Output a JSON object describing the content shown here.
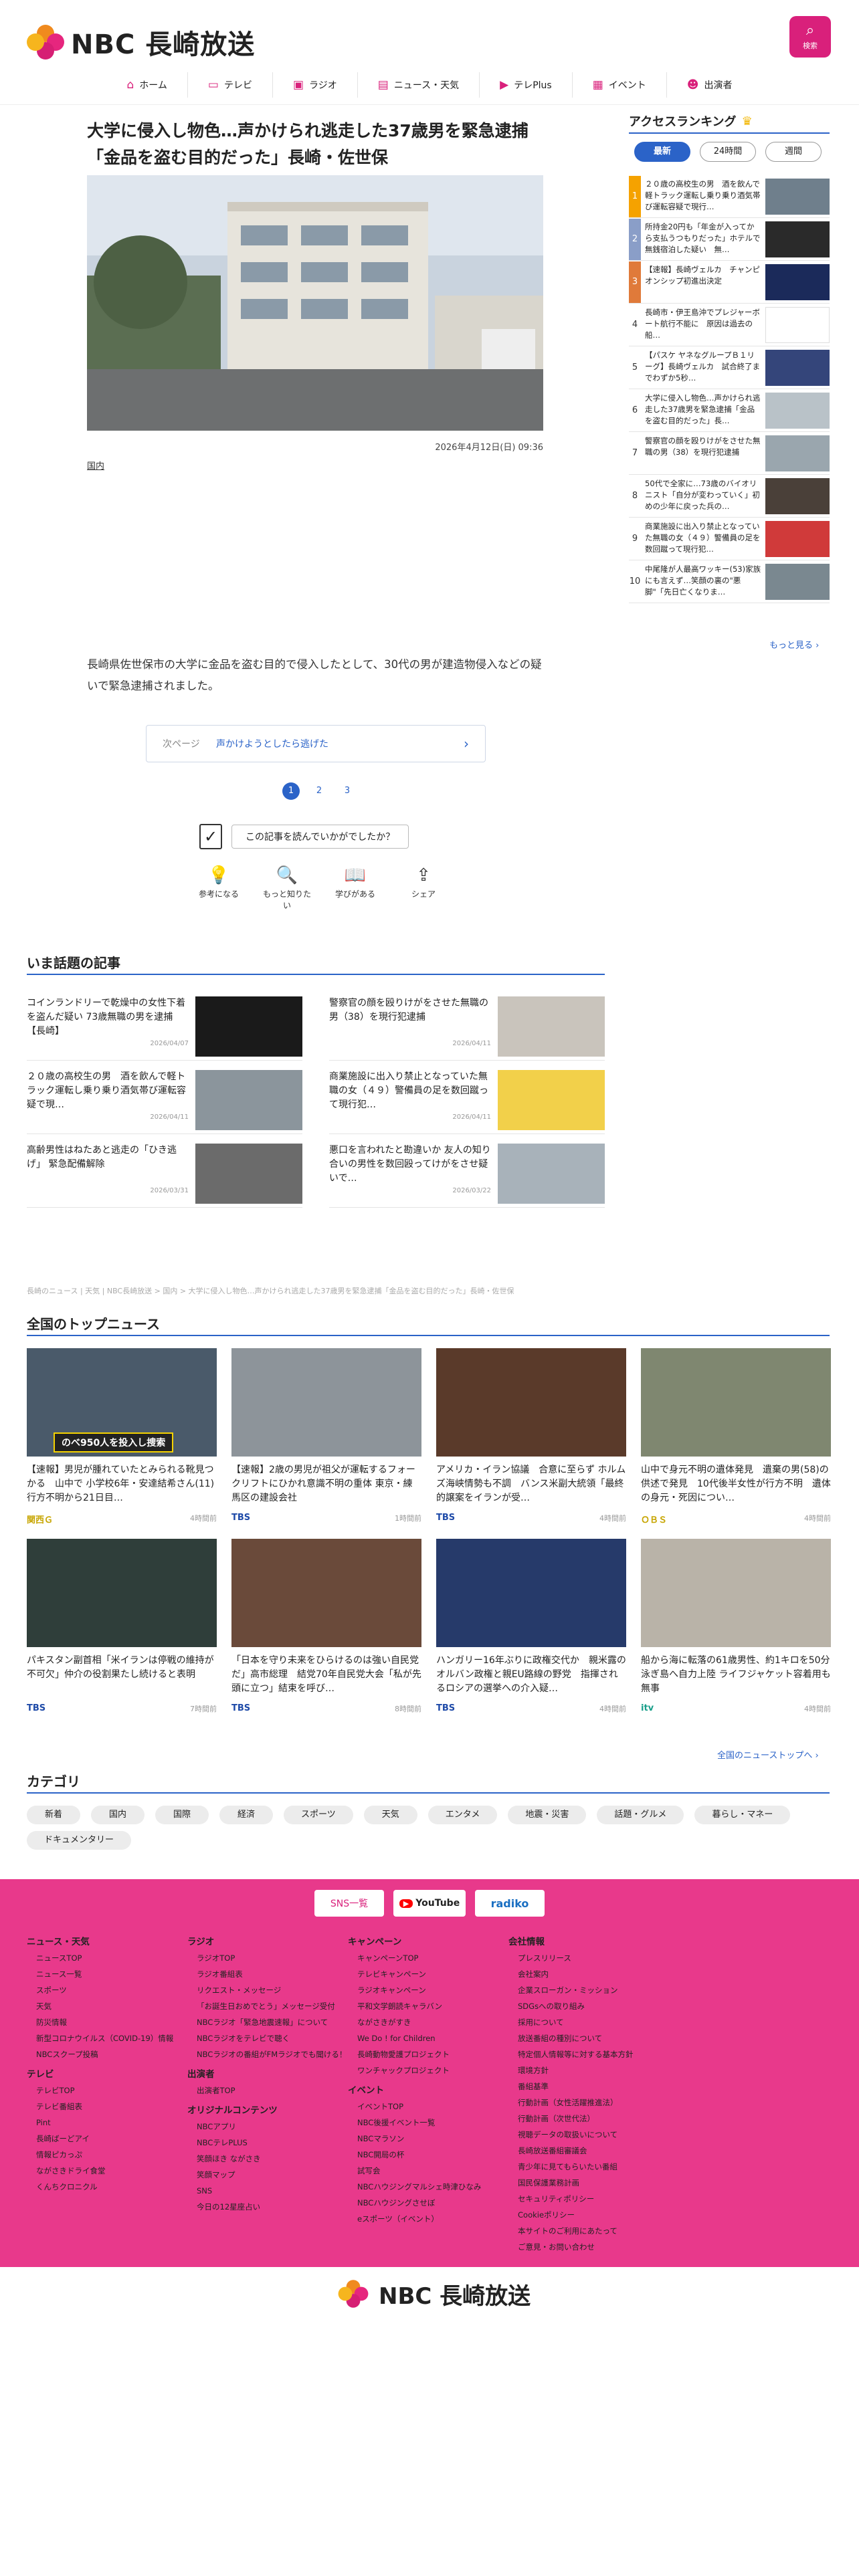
{
  "site": {
    "logo_text": "NBC 長崎放送",
    "search_label": "検索"
  },
  "gnav": [
    {
      "icon": "home-icon",
      "glyph": "⌂",
      "label": "ホーム"
    },
    {
      "icon": "tv-icon",
      "glyph": "▭",
      "label": "テレビ"
    },
    {
      "icon": "radio-icon",
      "glyph": "▣",
      "label": "ラジオ"
    },
    {
      "icon": "news-icon",
      "glyph": "▤",
      "label": "ニュース・天気"
    },
    {
      "icon": "play-icon",
      "glyph": "▶",
      "label": "テレPlus"
    },
    {
      "icon": "calendar-icon",
      "glyph": "▦",
      "label": "イベント"
    },
    {
      "icon": "people-icon",
      "glyph": "☻",
      "label": "出演者"
    }
  ],
  "article": {
    "headline": "大学に侵入し物色…声かけられ逃走した37歳男を緊急逮捕「金品を盗む目的だった」長崎・佐世保",
    "date": "2026年4月12日(日) 09:36",
    "category": "国内",
    "lead": "長崎県佐世保市の大学に金品を盗む目的で侵入したとして、30代の男が建造物侵入などの疑いで緊急逮捕されました。",
    "next_label": "次ページ",
    "next_title": "声かけようとしたら逃げた",
    "pages": [
      "1",
      "2",
      "3"
    ],
    "feedback_q": "この記事を読んでいかがでしたか？",
    "reactions": [
      {
        "icon": "lightbulb-icon",
        "glyph": "💡",
        "label": "参考になる"
      },
      {
        "icon": "search-icon",
        "glyph": "🔍",
        "label": "もっと知りたい"
      },
      {
        "icon": "book-icon",
        "glyph": "📖",
        "label": "学びがある"
      },
      {
        "icon": "share-icon",
        "glyph": "⇪",
        "label": "シェア"
      }
    ]
  },
  "ranking": {
    "title": "アクセスランキング",
    "tabs": [
      "最新",
      "24時間",
      "週間"
    ],
    "more": "もっと見る ›",
    "items": [
      {
        "n": "1",
        "t": "２０歳の高校生の男　酒を飲んで軽トラック運転し乗り乗り酒気帯び運転容疑で現行…"
      },
      {
        "n": "2",
        "t": "所持金20円も「年金が入ってから支払うつもりだった」ホテルで無銭宿泊した疑い　無…"
      },
      {
        "n": "3",
        "t": "【速報】長崎ヴェルカ　チャンピオンシップ初進出決定"
      },
      {
        "n": "4",
        "t": "長崎市・伊王島沖でプレジャーボート航行不能に　原因は過去の船…"
      },
      {
        "n": "5",
        "t": "【パスケ ヤネなグループＢ１リーグ】長崎ヴェルカ　試合終了までわずか5秒…"
      },
      {
        "n": "6",
        "t": "大学に侵入し物色…声かけられ逃走した37歳男を緊急逮捕「金品を盗む目的だった」長…"
      },
      {
        "n": "7",
        "t": "警察官の顔を殴りけがをさせた無職の男（38）を現行犯逮捕"
      },
      {
        "n": "8",
        "t": "50代で全家に…73歳のバイオリニスト「自分が変わっていく」初めの少年に戻った兵の…"
      },
      {
        "n": "9",
        "t": "商業施設に出入り禁止となっていた無職の女（４９）警備員の足を数回蹴って現行犯…"
      },
      {
        "n": "10",
        "t": "中尾隆が人最高ワッキー(53)家族にも言えず…笑顔の裏の\"悪脚\"「先日亡くなりま…"
      }
    ]
  },
  "trending": {
    "title": "いま話題の記事",
    "items": [
      {
        "t": "コインランドリーで乾燥中の女性下着を盗んだ疑い 73歳無職の男を逮捕【長崎】",
        "d": "2026/04/07"
      },
      {
        "t": "警察官の顔を殴りけがをさせた無職の男（38）を現行犯逮捕",
        "d": "2026/04/11"
      },
      {
        "t": "２０歳の高校生の男　酒を飲んで軽トラック運転し乗り乗り酒気帯び運転容疑で現…",
        "d": "2026/04/11"
      },
      {
        "t": "商業施設に出入り禁止となっていた無職の女（４９）警備員の足を数回蹴って現行犯…",
        "d": "2026/04/11"
      },
      {
        "t": "高齢男性はねたあと逃走の「ひき逃げ」 緊急配備解除",
        "d": "2026/03/31"
      },
      {
        "t": "悪口を言われたと勘違いか 友人の知り合いの男性を数回殴ってけがをさせ疑いで…",
        "d": "2026/03/22"
      }
    ]
  },
  "breadcrumb": "長崎のニュース | 天気 | NBC長崎放送 > 国内 > 大学に侵入し物色…声かけられ逃走した37歳男を緊急逮捕「金品を盗む目的だった」長崎・佐世保",
  "topnews": {
    "title": "全国のトップニュース",
    "more": "全国のニューストップへ ›",
    "items": [
      {
        "t": "【速報】男児が腫れていたとみられる靴見つかる　山中で 小学校6年・安達結希さん(11) 行方不明から21日目…",
        "src": "関西Ｇ",
        "ago": "4時間前",
        "cap": "のべ950人を投入し捜索"
      },
      {
        "t": "【速報】2歳の男児が祖父が運転するフォークリフトにひかれ意識不明の重体 東京・練馬区の建設会社",
        "src": "TBS",
        "ago": "1時間前",
        "cap": ""
      },
      {
        "t": "アメリカ・イラン協議　合意に至らず ホルムズ海峡情勢も不調　バンス米副大統領「最終的譲案をイランが受…",
        "src": "TBS",
        "ago": "4時間前",
        "cap": ""
      },
      {
        "t": "山中で身元不明の遺体発見　遺棄の男(58)の供述で発見　10代後半女性が行方不明　遺体の身元・死因につい…",
        "src": "ＯＢＳ",
        "ago": "4時間前",
        "cap": ""
      },
      {
        "t": "パキスタン副首相「米イランは停戦の維持が不可欠」仲介の役割果たし続けると表明",
        "src": "TBS",
        "ago": "7時間前",
        "cap": ""
      },
      {
        "t": "「日本を守り未来をひらけるのは強い自民党だ」高市総理　結党70年自民党大会「私が先頭に立つ」結束を呼び…",
        "src": "TBS",
        "ago": "8時間前",
        "cap": ""
      },
      {
        "t": "ハンガリー16年ぶりに政権交代か　親米露のオルバン政権と親EU路線の野党　指揮されるロシアの選挙への介入疑…",
        "src": "TBS",
        "ago": "4時間前",
        "cap": ""
      },
      {
        "t": "船から海に転落の61歳男性、約1キロを50分泳ぎ島へ自力上陸 ライフジャケット容着用も無事",
        "src": "itv",
        "ago": "4時間前",
        "cap": ""
      }
    ]
  },
  "categories": {
    "title": "カテゴリ",
    "items": [
      "新着",
      "国内",
      "国際",
      "経済",
      "スポーツ",
      "天気",
      "エンタメ",
      "地震・災害",
      "話題・グルメ",
      "暮らし・マネー",
      "ドキュメンタリー"
    ]
  },
  "footer": {
    "sns": [
      "SNS一覧",
      "YouTube",
      "radiko"
    ],
    "cols": [
      [
        {
          "h": "ニュース・天気",
          "items": [
            "ニュースTOP",
            "ニュース一覧",
            "スポーツ",
            "天気",
            "防災情報",
            "新型コロナウイルス（COVID-19）情報",
            "NBCスクープ投稿"
          ]
        },
        {
          "h": "テレビ",
          "items": [
            "テレビTOP",
            "テレビ番組表",
            "Pint",
            "長崎ばーどアイ",
            "情報ピカっぷ",
            "ながさきドライ食堂",
            "くんちクロニクル"
          ]
        }
      ],
      [
        {
          "h": "ラジオ",
          "items": [
            "ラジオTOP",
            "ラジオ番組表",
            "リクエスト・メッセージ",
            "「お誕生日おめでとう」メッセージ受付",
            "NBCラジオ「緊急地震速報」について",
            "NBCラジオをテレビで聴く",
            "NBCラジオの番組がFMラジオでも聞ける！"
          ]
        },
        {
          "h": "出演者",
          "items": [
            "出演者TOP"
          ]
        },
        {
          "h": "オリジナルコンテンツ",
          "items": [
            "NBCアプリ",
            "NBCテレPLUS",
            "笑顔ほき ながさき",
            "笑顔マップ",
            "SNS",
            "今日の12星座占い"
          ]
        }
      ],
      [
        {
          "h": "キャンペーン",
          "items": [
            "キャンペーンTOP",
            "テレビキャンペーン",
            "ラジオキャンペーン",
            "平和文学朗読キャラバン",
            "ながさきがすき",
            "We Do ! for Children",
            "長崎動物愛護プロジェクト",
            "ワンチャックプロジェクト"
          ]
        },
        {
          "h": "イベント",
          "items": [
            "イベントTOP",
            "NBC後援イベント一覧",
            "NBCマラソン",
            "NBC開局の杯",
            "試写会",
            "NBCハウジングマルシェ時津ひなみ",
            "NBCハウジングさせぼ",
            "eスポーツ（イベント）"
          ]
        }
      ],
      [
        {
          "h": "会社情報",
          "items": [
            "プレスリリース",
            "会社案内",
            "企業スローガン・ミッション",
            "SDGsへの取り組み",
            "採用について",
            "放送番組の種別について",
            "特定個人情報等に対する基本方針",
            "環境方針",
            "番組基準",
            "行動計画（女性活躍推進法）",
            "行動計画（次世代法）",
            "視聴データの取扱いについて",
            "長崎放送番組審議会",
            "青少年に見てもらいたい番組",
            "国民保護業務計画",
            "セキュリティポリシー",
            "Cookieポリシー",
            "本サイトのご利用にあたって",
            "ご意見・お問い合わせ"
          ]
        }
      ]
    ]
  },
  "colors": {
    "accent": "#d9207b",
    "blue": "#2b63c8",
    "footer": "#e8398b"
  }
}
